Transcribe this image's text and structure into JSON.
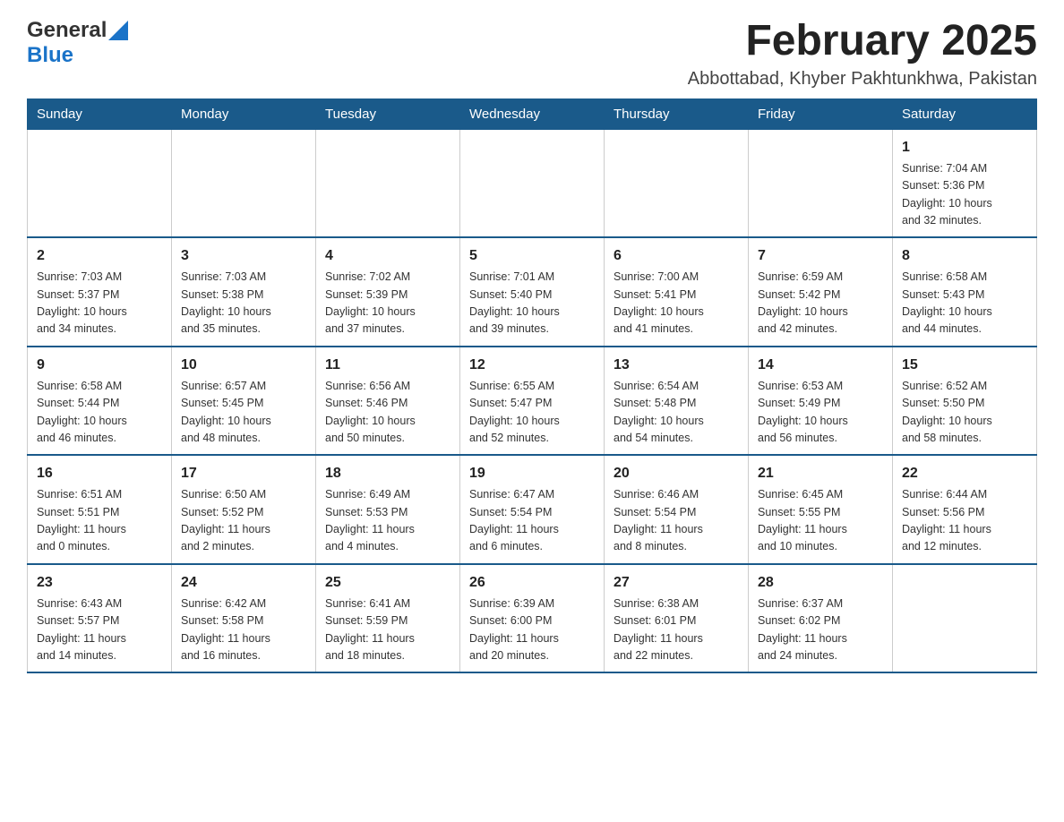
{
  "header": {
    "logo": {
      "text_general": "General",
      "text_blue": "Blue",
      "triangle_color": "#1a73c8"
    },
    "title": "February 2025",
    "subtitle": "Abbottabad, Khyber Pakhtunkhwa, Pakistan"
  },
  "days_of_week": [
    "Sunday",
    "Monday",
    "Tuesday",
    "Wednesday",
    "Thursday",
    "Friday",
    "Saturday"
  ],
  "weeks": [
    {
      "cells": [
        {
          "day": "",
          "info": ""
        },
        {
          "day": "",
          "info": ""
        },
        {
          "day": "",
          "info": ""
        },
        {
          "day": "",
          "info": ""
        },
        {
          "day": "",
          "info": ""
        },
        {
          "day": "",
          "info": ""
        },
        {
          "day": "1",
          "info": "Sunrise: 7:04 AM\nSunset: 5:36 PM\nDaylight: 10 hours\nand 32 minutes."
        }
      ]
    },
    {
      "cells": [
        {
          "day": "2",
          "info": "Sunrise: 7:03 AM\nSunset: 5:37 PM\nDaylight: 10 hours\nand 34 minutes."
        },
        {
          "day": "3",
          "info": "Sunrise: 7:03 AM\nSunset: 5:38 PM\nDaylight: 10 hours\nand 35 minutes."
        },
        {
          "day": "4",
          "info": "Sunrise: 7:02 AM\nSunset: 5:39 PM\nDaylight: 10 hours\nand 37 minutes."
        },
        {
          "day": "5",
          "info": "Sunrise: 7:01 AM\nSunset: 5:40 PM\nDaylight: 10 hours\nand 39 minutes."
        },
        {
          "day": "6",
          "info": "Sunrise: 7:00 AM\nSunset: 5:41 PM\nDaylight: 10 hours\nand 41 minutes."
        },
        {
          "day": "7",
          "info": "Sunrise: 6:59 AM\nSunset: 5:42 PM\nDaylight: 10 hours\nand 42 minutes."
        },
        {
          "day": "8",
          "info": "Sunrise: 6:58 AM\nSunset: 5:43 PM\nDaylight: 10 hours\nand 44 minutes."
        }
      ]
    },
    {
      "cells": [
        {
          "day": "9",
          "info": "Sunrise: 6:58 AM\nSunset: 5:44 PM\nDaylight: 10 hours\nand 46 minutes."
        },
        {
          "day": "10",
          "info": "Sunrise: 6:57 AM\nSunset: 5:45 PM\nDaylight: 10 hours\nand 48 minutes."
        },
        {
          "day": "11",
          "info": "Sunrise: 6:56 AM\nSunset: 5:46 PM\nDaylight: 10 hours\nand 50 minutes."
        },
        {
          "day": "12",
          "info": "Sunrise: 6:55 AM\nSunset: 5:47 PM\nDaylight: 10 hours\nand 52 minutes."
        },
        {
          "day": "13",
          "info": "Sunrise: 6:54 AM\nSunset: 5:48 PM\nDaylight: 10 hours\nand 54 minutes."
        },
        {
          "day": "14",
          "info": "Sunrise: 6:53 AM\nSunset: 5:49 PM\nDaylight: 10 hours\nand 56 minutes."
        },
        {
          "day": "15",
          "info": "Sunrise: 6:52 AM\nSunset: 5:50 PM\nDaylight: 10 hours\nand 58 minutes."
        }
      ]
    },
    {
      "cells": [
        {
          "day": "16",
          "info": "Sunrise: 6:51 AM\nSunset: 5:51 PM\nDaylight: 11 hours\nand 0 minutes."
        },
        {
          "day": "17",
          "info": "Sunrise: 6:50 AM\nSunset: 5:52 PM\nDaylight: 11 hours\nand 2 minutes."
        },
        {
          "day": "18",
          "info": "Sunrise: 6:49 AM\nSunset: 5:53 PM\nDaylight: 11 hours\nand 4 minutes."
        },
        {
          "day": "19",
          "info": "Sunrise: 6:47 AM\nSunset: 5:54 PM\nDaylight: 11 hours\nand 6 minutes."
        },
        {
          "day": "20",
          "info": "Sunrise: 6:46 AM\nSunset: 5:54 PM\nDaylight: 11 hours\nand 8 minutes."
        },
        {
          "day": "21",
          "info": "Sunrise: 6:45 AM\nSunset: 5:55 PM\nDaylight: 11 hours\nand 10 minutes."
        },
        {
          "day": "22",
          "info": "Sunrise: 6:44 AM\nSunset: 5:56 PM\nDaylight: 11 hours\nand 12 minutes."
        }
      ]
    },
    {
      "cells": [
        {
          "day": "23",
          "info": "Sunrise: 6:43 AM\nSunset: 5:57 PM\nDaylight: 11 hours\nand 14 minutes."
        },
        {
          "day": "24",
          "info": "Sunrise: 6:42 AM\nSunset: 5:58 PM\nDaylight: 11 hours\nand 16 minutes."
        },
        {
          "day": "25",
          "info": "Sunrise: 6:41 AM\nSunset: 5:59 PM\nDaylight: 11 hours\nand 18 minutes."
        },
        {
          "day": "26",
          "info": "Sunrise: 6:39 AM\nSunset: 6:00 PM\nDaylight: 11 hours\nand 20 minutes."
        },
        {
          "day": "27",
          "info": "Sunrise: 6:38 AM\nSunset: 6:01 PM\nDaylight: 11 hours\nand 22 minutes."
        },
        {
          "day": "28",
          "info": "Sunrise: 6:37 AM\nSunset: 6:02 PM\nDaylight: 11 hours\nand 24 minutes."
        },
        {
          "day": "",
          "info": ""
        }
      ]
    }
  ]
}
